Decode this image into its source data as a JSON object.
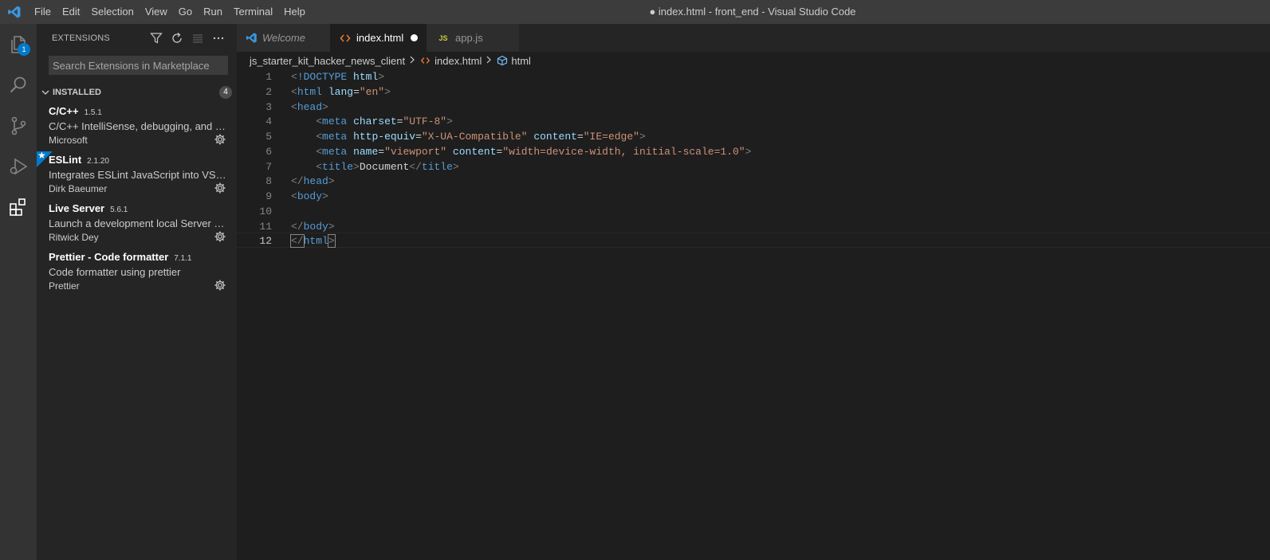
{
  "window": {
    "title": "● index.html - front_end - Visual Studio Code",
    "menu": [
      "File",
      "Edit",
      "Selection",
      "View",
      "Go",
      "Run",
      "Terminal",
      "Help"
    ]
  },
  "activity_bar": {
    "explorer_badge": "1",
    "items": [
      "explorer-icon",
      "search-icon",
      "source-control-icon",
      "run-debug-icon",
      "extensions-icon"
    ]
  },
  "sidebar": {
    "title": "EXTENSIONS",
    "search_placeholder": "Search Extensions in Marketplace",
    "section": {
      "title": "INSTALLED",
      "count": "4"
    },
    "extensions": [
      {
        "name": "C/C++",
        "version": "1.5.1",
        "description": "C/C++ IntelliSense, debugging, and code browsing.",
        "publisher": "Microsoft",
        "starred": false
      },
      {
        "name": "ESLint",
        "version": "2.1.20",
        "description": "Integrates ESLint JavaScript into VS Code.",
        "publisher": "Dirk Baeumer",
        "starred": true
      },
      {
        "name": "Live Server",
        "version": "5.6.1",
        "description": "Launch a development local Server with live reload feature for static & dynamic pages",
        "publisher": "Ritwick Dey",
        "starred": false
      },
      {
        "name": "Prettier - Code formatter",
        "version": "7.1.1",
        "description": "Code formatter using prettier",
        "publisher": "Prettier",
        "starred": false
      }
    ]
  },
  "tabs": [
    {
      "label": "Welcome",
      "icon": "vscode-logo-icon",
      "state": "inactive",
      "italic": true
    },
    {
      "label": "index.html",
      "icon": "html-file-icon",
      "state": "active",
      "dirty": true
    },
    {
      "label": "app.js",
      "icon": "js-file-icon",
      "icon_text": "JS",
      "state": "inactive"
    }
  ],
  "breadcrumb": [
    "js_starter_kit_hacker_news_client",
    "index.html",
    "html"
  ],
  "editor": {
    "current_line": 12,
    "lines": [
      {
        "n": "1",
        "tokens": [
          [
            "punct",
            "<"
          ],
          [
            "tag",
            "!DOCTYPE"
          ],
          [
            "text",
            " "
          ],
          [
            "attr",
            "html"
          ],
          [
            "punct",
            ">"
          ]
        ]
      },
      {
        "n": "2",
        "tokens": [
          [
            "punct",
            "<"
          ],
          [
            "tag",
            "html"
          ],
          [
            "text",
            " "
          ],
          [
            "attr",
            "lang"
          ],
          [
            "text",
            "="
          ],
          [
            "str",
            "\"en\""
          ],
          [
            "punct",
            ">"
          ]
        ]
      },
      {
        "n": "3",
        "tokens": [
          [
            "punct",
            "<"
          ],
          [
            "tag",
            "head"
          ],
          [
            "punct",
            ">"
          ]
        ]
      },
      {
        "n": "4",
        "tokens": [
          [
            "text",
            "    "
          ],
          [
            "punct",
            "<"
          ],
          [
            "tag",
            "meta"
          ],
          [
            "text",
            " "
          ],
          [
            "attr",
            "charset"
          ],
          [
            "text",
            "="
          ],
          [
            "str",
            "\"UTF-8\""
          ],
          [
            "punct",
            ">"
          ]
        ]
      },
      {
        "n": "5",
        "tokens": [
          [
            "text",
            "    "
          ],
          [
            "punct",
            "<"
          ],
          [
            "tag",
            "meta"
          ],
          [
            "text",
            " "
          ],
          [
            "attr",
            "http-equiv"
          ],
          [
            "text",
            "="
          ],
          [
            "str",
            "\"X-UA-Compatible\""
          ],
          [
            "text",
            " "
          ],
          [
            "attr",
            "content"
          ],
          [
            "text",
            "="
          ],
          [
            "str",
            "\"IE=edge\""
          ],
          [
            "punct",
            ">"
          ]
        ]
      },
      {
        "n": "6",
        "tokens": [
          [
            "text",
            "    "
          ],
          [
            "punct",
            "<"
          ],
          [
            "tag",
            "meta"
          ],
          [
            "text",
            " "
          ],
          [
            "attr",
            "name"
          ],
          [
            "text",
            "="
          ],
          [
            "str",
            "\"viewport\""
          ],
          [
            "text",
            " "
          ],
          [
            "attr",
            "content"
          ],
          [
            "text",
            "="
          ],
          [
            "str",
            "\"width=device-width, initial-scale=1.0\""
          ],
          [
            "punct",
            ">"
          ]
        ]
      },
      {
        "n": "7",
        "tokens": [
          [
            "text",
            "    "
          ],
          [
            "punct",
            "<"
          ],
          [
            "tag",
            "title"
          ],
          [
            "punct",
            ">"
          ],
          [
            "text",
            "Document"
          ],
          [
            "punct",
            "</"
          ],
          [
            "tag",
            "title"
          ],
          [
            "punct",
            ">"
          ]
        ]
      },
      {
        "n": "8",
        "tokens": [
          [
            "punct",
            "</"
          ],
          [
            "tag",
            "head"
          ],
          [
            "punct",
            ">"
          ]
        ]
      },
      {
        "n": "9",
        "tokens": [
          [
            "punct",
            "<"
          ],
          [
            "tag",
            "body"
          ],
          [
            "punct",
            ">"
          ]
        ]
      },
      {
        "n": "10",
        "tokens": []
      },
      {
        "n": "11",
        "tokens": [
          [
            "punct",
            "</"
          ],
          [
            "tag",
            "body"
          ],
          [
            "punct",
            ">"
          ]
        ]
      },
      {
        "n": "12",
        "tokens": [
          [
            "punct",
            "</"
          ],
          [
            "tag",
            "html"
          ],
          [
            "punct",
            ">"
          ]
        ]
      }
    ]
  },
  "colors": {
    "accent": "#007acc",
    "titlebar": "#3c3c3c",
    "activitybar": "#333333",
    "sidebar": "#252526",
    "editor": "#1e1e1e"
  }
}
